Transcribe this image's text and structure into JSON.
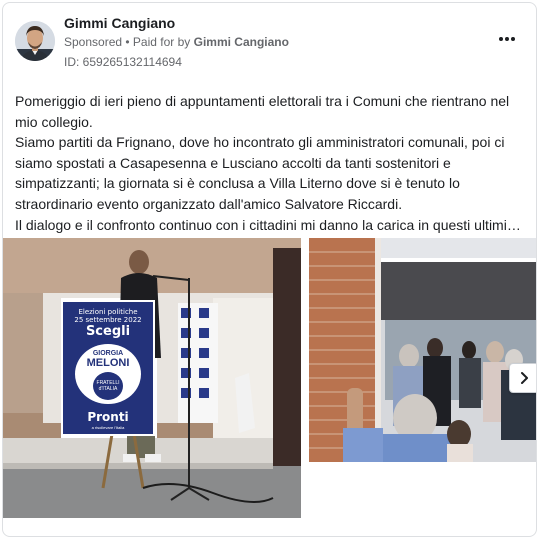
{
  "header": {
    "page_name": "Gimmi Cangiano",
    "sponsored_label": "Sponsored",
    "separator": " • ",
    "paid_for_prefix": "Paid for by ",
    "paid_for_name": "Gimmi Cangiano",
    "ad_id": "ID: 659265132114694"
  },
  "body": {
    "lines": [
      "Pomeriggio di ieri pieno di appuntamenti elettorali tra i Comuni che rientrano nel",
      "mio collegio.",
      "Siamo partiti da Frignano, dove ho incontrato gli amministratori comunali, poi ci",
      "siamo spostati a Casapesenna e Lusciano accolti da tanti sostenitori e",
      "simpatizzanti; la giornata si è conclusa a Villa Literno dove si è tenuto lo",
      "straordinario evento organizzato dall'amico Salvatore Riccardi.",
      "Il dialogo e il confronto continuo con i cittadini mi danno la carica in questi ultimi…"
    ]
  },
  "poster": {
    "line1": "Elezioni politiche",
    "line2": "25 settembre 2022",
    "cta1": "Scegli",
    "brand1": "GIORGIA",
    "brand2": "MELONI",
    "party1": "FRATELLI",
    "party2": "d'ITALIA",
    "cta2": "Pronti",
    "small": "a risollevare l'Italia"
  },
  "icons": {
    "more": "more-dots-icon",
    "next": "chevron-right-icon"
  },
  "colors": {
    "text": "#1c1e21",
    "secondary": "#65676b",
    "border": "#dddfe2",
    "poster_blue": "#23327a"
  }
}
